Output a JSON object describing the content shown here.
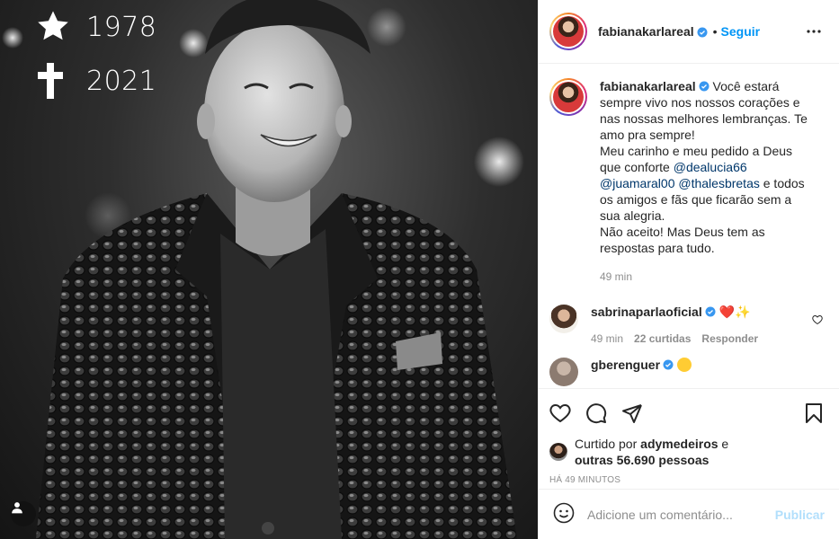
{
  "photo": {
    "overlay": [
      {
        "symbol": "star-icon",
        "year": "1978"
      },
      {
        "symbol": "cross-icon",
        "year": "2021"
      }
    ],
    "tag_icon": "user-icon"
  },
  "header": {
    "username": "fabianakarlareal",
    "separator": "•",
    "follow_label": "Seguir",
    "more_icon": "more-icon"
  },
  "caption": {
    "username": "fabianakarlareal",
    "text_1": "Você estará sempre vivo nos nossos corações e nas nossas melhores lembranças. Te amo pra sempre!\nMeu carinho e meu pedido a Deus que conforte ",
    "mention_1": "@dealucia66",
    "mention_2": "@juamaral00",
    "mention_3": "@thalesbretas",
    "text_2": " e todos os amigos e fãs que ficarão sem a sua alegria.\nNão aceito! Mas Deus tem as respostas para tudo.",
    "time": "49 min"
  },
  "comments": [
    {
      "username": "sabrinaparlaoficial",
      "emoji_1": "❤️",
      "emoji_2": "✨",
      "time": "49 min",
      "likes": "22 curtidas",
      "reply_label": "Responder"
    },
    {
      "username": "gberenguer"
    }
  ],
  "actions": {
    "like_icon": "heart-icon",
    "comment_icon": "comment-icon",
    "share_icon": "share-icon",
    "save_icon": "bookmark-icon"
  },
  "liked_by": {
    "prefix": "Curtido por ",
    "user": "adymedeiros",
    "middle": " e ",
    "others": "outras 56.690 pessoas"
  },
  "timestamp": "HÁ 49 MINUTOS",
  "add_comment": {
    "placeholder": "Adicione um comentário...",
    "publish_label": "Publicar"
  },
  "colors": {
    "accent": "#0095f6",
    "mention": "#00376b",
    "secondary_text": "#8e8e8e",
    "publish_disabled": "#b2dffc",
    "border": "#efefef"
  }
}
